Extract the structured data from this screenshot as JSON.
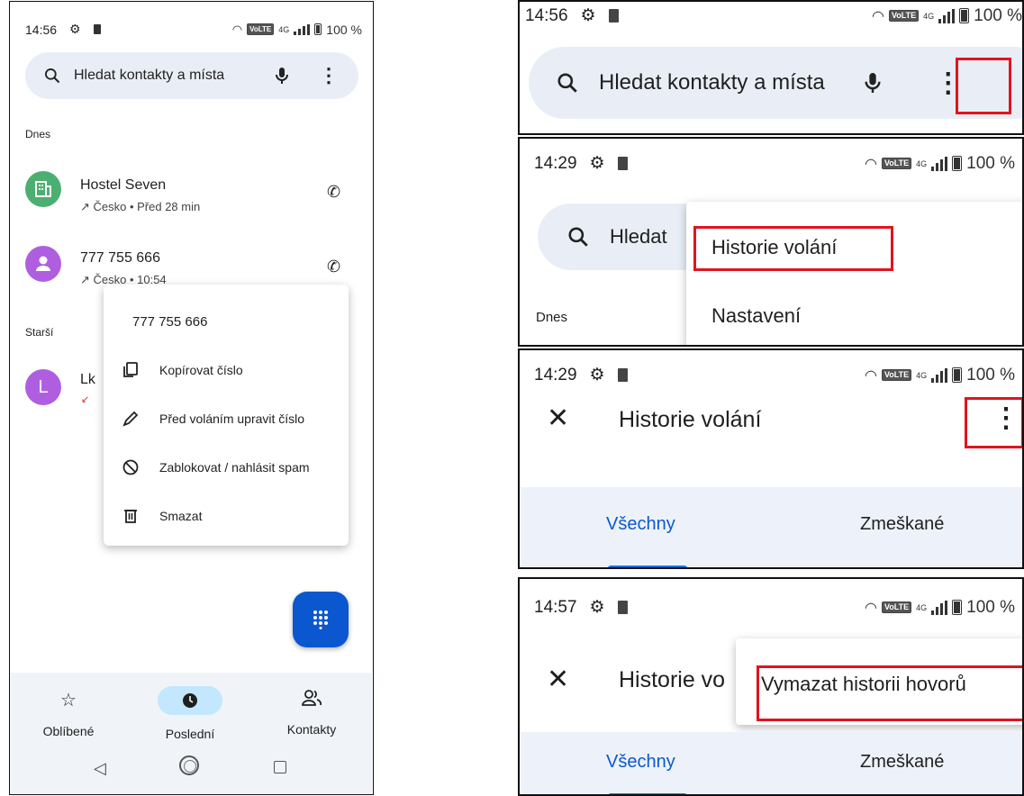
{
  "phone": {
    "status": {
      "time": "14:56",
      "battery": "100 %",
      "network": "4G",
      "volte": "VoLTE"
    },
    "search": {
      "placeholder": "Hledat kontakty a místa"
    },
    "sections": {
      "today": "Dnes",
      "older": "Starší"
    },
    "calls": [
      {
        "name": "Hostel Seven",
        "detail": "↗ Česko • Před 28 min",
        "avatar_color": "#4caf72"
      },
      {
        "name": "777 755 666",
        "detail": "↗ Česko • 10:54",
        "avatar_color": "#b05ee0"
      },
      {
        "name": "Lk",
        "initial": "L",
        "avatar_color": "#b05ee0"
      }
    ],
    "context_menu": {
      "title": "777 755 666",
      "items": [
        "Kopírovat číslo",
        "Před voláním upravit číslo",
        "Zablokovat / nahlásit spam",
        "Smazat"
      ]
    },
    "bottom_nav": [
      "Oblíbené",
      "Poslední",
      "Kontakty"
    ]
  },
  "step1": {
    "time": "14:56",
    "battery": "100 %",
    "network": "4G",
    "volte": "VoLTE",
    "search_text": "Hledat kontakty a místa"
  },
  "step2": {
    "time": "14:29",
    "battery": "100 %",
    "network": "4G",
    "volte": "VoLTE",
    "search_text": "Hledat",
    "section": "Dnes",
    "menu": [
      "Historie volání",
      "Nastavení"
    ]
  },
  "step3": {
    "time": "14:29",
    "battery": "100 %",
    "network": "4G",
    "volte": "VoLTE",
    "title": "Historie volání",
    "tabs": [
      "Všechny",
      "Zmeškané"
    ]
  },
  "step4": {
    "time": "14:57",
    "battery": "100 %",
    "network": "4G",
    "volte": "VoLTE",
    "title": "Historie vo",
    "menu_item": "Vymazat historii hovorů",
    "tabs": [
      "Všechny",
      "Zmeškané"
    ]
  },
  "colors": {
    "accent": "#0b57d0",
    "highlight": "#e0141e",
    "search_bg": "#e9eef6",
    "nav_bg": "#f0f4f9"
  }
}
